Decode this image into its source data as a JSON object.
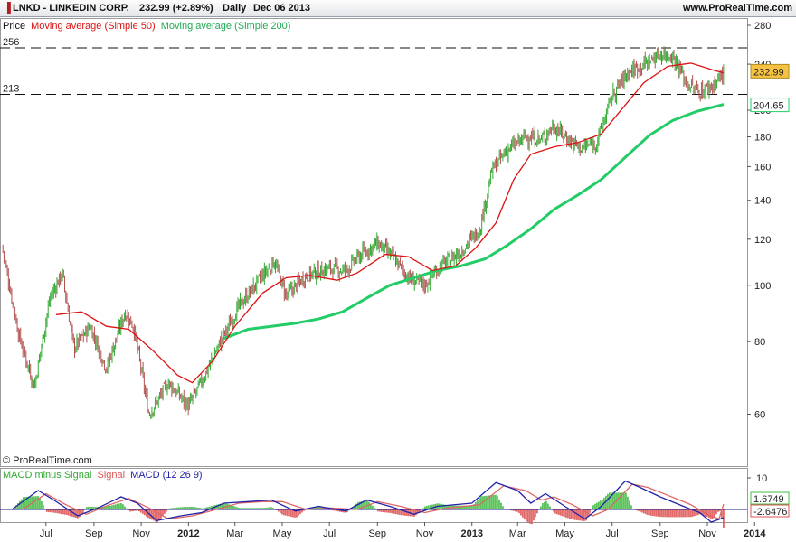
{
  "header": {
    "symbol": "LNKD - LINKEDIN CORP.",
    "price_change": "232.99 (+2.89%)",
    "period": "Daily",
    "date": "Dec 06 2013",
    "site": "www.ProRealTime.com"
  },
  "legend": {
    "price": "Price",
    "ma50": "Moving average (Simple 50)",
    "ma200": "Moving average (Simple 200)",
    "macd_hist": "MACD minus Signal",
    "macd_signal": "Signal",
    "macd_line": "MACD (12 26 9)"
  },
  "copyright": "© ProRealTime.com",
  "colors": {
    "up": "#33aa33",
    "down": "#b05050",
    "ma50": "#dd1111",
    "ma200": "#22cc66",
    "macd": "#2222aa",
    "signal": "#dd6666",
    "hist_pos": "#44bb44",
    "hist_neg": "#dd5555",
    "zero_line": "#1a1a8c",
    "price_tag": "#f5c244"
  },
  "chart_data": [
    {
      "type": "candlestick",
      "title": "LNKD - LINKEDIN CORP.",
      "scale": "log",
      "ylim": [
        54,
        280
      ],
      "yticks": [
        60,
        80,
        100,
        120,
        140,
        160,
        180,
        200,
        240,
        280
      ],
      "xticks": [
        "Jul",
        "Sep",
        "Nov",
        "2012",
        "Mar",
        "May",
        "Jul",
        "Sep",
        "Nov",
        "2013",
        "Mar",
        "May",
        "Jul",
        "Sep",
        "Nov",
        "2014"
      ],
      "x_start": "2011-05-19",
      "x_end": "2013-12-06",
      "horizontal_levels": [
        {
          "label": "256",
          "value": 256
        },
        {
          "label": "213",
          "value": 213
        }
      ],
      "last_price": {
        "label": "232.99",
        "value": 232.99
      },
      "ma200_last": {
        "label": "204.65",
        "value": 204.65
      },
      "price_path": [
        {
          "date": "2011-05-19",
          "close": 117
        },
        {
          "date": "2011-06-10",
          "close": 82
        },
        {
          "date": "2011-06-30",
          "close": 67
        },
        {
          "date": "2011-07-20",
          "close": 95
        },
        {
          "date": "2011-08-05",
          "close": 105
        },
        {
          "date": "2011-08-20",
          "close": 78
        },
        {
          "date": "2011-09-10",
          "close": 85
        },
        {
          "date": "2011-10-01",
          "close": 72
        },
        {
          "date": "2011-10-25",
          "close": 90
        },
        {
          "date": "2011-11-05",
          "close": 85
        },
        {
          "date": "2011-11-25",
          "close": 60
        },
        {
          "date": "2011-12-20",
          "close": 68
        },
        {
          "date": "2012-01-15",
          "close": 62
        },
        {
          "date": "2012-02-05",
          "close": 70
        },
        {
          "date": "2012-02-25",
          "close": 80
        },
        {
          "date": "2012-03-20",
          "close": 92
        },
        {
          "date": "2012-04-15",
          "close": 102
        },
        {
          "date": "2012-05-05",
          "close": 110
        },
        {
          "date": "2012-05-20",
          "close": 96
        },
        {
          "date": "2012-06-15",
          "close": 104
        },
        {
          "date": "2012-07-15",
          "close": 107
        },
        {
          "date": "2012-08-05",
          "close": 106
        },
        {
          "date": "2012-08-25",
          "close": 113
        },
        {
          "date": "2012-09-15",
          "close": 118
        },
        {
          "date": "2012-10-05",
          "close": 112
        },
        {
          "date": "2012-10-25",
          "close": 103
        },
        {
          "date": "2012-11-15",
          "close": 100
        },
        {
          "date": "2012-12-05",
          "close": 108
        },
        {
          "date": "2012-12-31",
          "close": 114
        },
        {
          "date": "2013-01-25",
          "close": 125
        },
        {
          "date": "2013-02-10",
          "close": 158
        },
        {
          "date": "2013-02-28",
          "close": 170
        },
        {
          "date": "2013-03-25",
          "close": 180
        },
        {
          "date": "2013-04-15",
          "close": 178
        },
        {
          "date": "2013-04-30",
          "close": 188
        },
        {
          "date": "2013-05-20",
          "close": 178
        },
        {
          "date": "2013-06-05",
          "close": 172
        },
        {
          "date": "2013-06-25",
          "close": 176
        },
        {
          "date": "2013-07-15",
          "close": 212
        },
        {
          "date": "2013-08-05",
          "close": 233
        },
        {
          "date": "2013-08-25",
          "close": 240
        },
        {
          "date": "2013-09-15",
          "close": 250
        },
        {
          "date": "2013-10-01",
          "close": 248
        },
        {
          "date": "2013-10-20",
          "close": 222
        },
        {
          "date": "2013-11-05",
          "close": 215
        },
        {
          "date": "2013-11-25",
          "close": 222
        },
        {
          "date": "2013-12-06",
          "close": 232.99
        }
      ],
      "ma50": [
        {
          "date": "2011-07-28",
          "value": 89
        },
        {
          "date": "2011-08-30",
          "value": 90
        },
        {
          "date": "2011-10-01",
          "value": 85
        },
        {
          "date": "2011-10-30",
          "value": 84
        },
        {
          "date": "2011-12-01",
          "value": 77
        },
        {
          "date": "2012-01-01",
          "value": 70
        },
        {
          "date": "2012-01-20",
          "value": 68
        },
        {
          "date": "2012-02-15",
          "value": 74
        },
        {
          "date": "2012-03-15",
          "value": 85
        },
        {
          "date": "2012-04-20",
          "value": 97
        },
        {
          "date": "2012-05-20",
          "value": 103
        },
        {
          "date": "2012-06-20",
          "value": 104
        },
        {
          "date": "2012-07-25",
          "value": 102
        },
        {
          "date": "2012-08-20",
          "value": 105
        },
        {
          "date": "2012-09-25",
          "value": 113
        },
        {
          "date": "2012-10-25",
          "value": 112
        },
        {
          "date": "2012-11-25",
          "value": 106
        },
        {
          "date": "2012-12-25",
          "value": 108
        },
        {
          "date": "2013-01-20",
          "value": 116
        },
        {
          "date": "2013-02-15",
          "value": 128
        },
        {
          "date": "2013-03-10",
          "value": 152
        },
        {
          "date": "2013-04-01",
          "value": 168
        },
        {
          "date": "2013-05-01",
          "value": 173
        },
        {
          "date": "2013-06-01",
          "value": 176
        },
        {
          "date": "2013-07-01",
          "value": 182
        },
        {
          "date": "2013-07-25",
          "value": 199
        },
        {
          "date": "2013-08-25",
          "value": 223
        },
        {
          "date": "2013-09-25",
          "value": 238
        },
        {
          "date": "2013-10-25",
          "value": 241
        },
        {
          "date": "2013-11-25",
          "value": 234
        },
        {
          "date": "2013-12-06",
          "value": 232
        }
      ],
      "ma200": [
        {
          "date": "2012-03-01",
          "value": 81
        },
        {
          "date": "2012-04-01",
          "value": 84
        },
        {
          "date": "2012-05-01",
          "value": 85
        },
        {
          "date": "2012-06-01",
          "value": 86
        },
        {
          "date": "2012-07-01",
          "value": 87.5
        },
        {
          "date": "2012-08-01",
          "value": 90
        },
        {
          "date": "2012-09-01",
          "value": 95
        },
        {
          "date": "2012-10-01",
          "value": 100
        },
        {
          "date": "2012-11-01",
          "value": 103
        },
        {
          "date": "2012-12-01",
          "value": 106
        },
        {
          "date": "2013-01-01",
          "value": 108
        },
        {
          "date": "2013-02-01",
          "value": 111
        },
        {
          "date": "2013-03-01",
          "value": 117
        },
        {
          "date": "2013-04-01",
          "value": 125
        },
        {
          "date": "2013-05-01",
          "value": 135
        },
        {
          "date": "2013-06-01",
          "value": 143
        },
        {
          "date": "2013-07-01",
          "value": 152
        },
        {
          "date": "2013-08-01",
          "value": 166
        },
        {
          "date": "2013-09-01",
          "value": 181
        },
        {
          "date": "2013-10-01",
          "value": 192
        },
        {
          "date": "2013-11-01",
          "value": 199
        },
        {
          "date": "2013-12-06",
          "value": 204.65
        }
      ]
    },
    {
      "type": "macd",
      "title": "MACD (12 26 9)",
      "ylim": [
        -4,
        12
      ],
      "yticks": [
        10
      ],
      "last_macd": {
        "label": "1.6749",
        "value": 1.6749
      },
      "last_signal": {
        "label": "-2.6476",
        "value": -2.6476
      },
      "macd": [
        {
          "date": "2011-06-01",
          "value": 0
        },
        {
          "date": "2011-07-05",
          "value": 6
        },
        {
          "date": "2011-07-25",
          "value": 3
        },
        {
          "date": "2011-08-25",
          "value": -2
        },
        {
          "date": "2011-09-20",
          "value": 0.5
        },
        {
          "date": "2011-10-20",
          "value": 4
        },
        {
          "date": "2011-11-10",
          "value": 2
        },
        {
          "date": "2011-12-05",
          "value": -3.5
        },
        {
          "date": "2012-01-05",
          "value": -2
        },
        {
          "date": "2012-02-01",
          "value": -1
        },
        {
          "date": "2012-03-01",
          "value": 2
        },
        {
          "date": "2012-04-01",
          "value": 2.5
        },
        {
          "date": "2012-05-01",
          "value": 3
        },
        {
          "date": "2012-06-01",
          "value": -0.5
        },
        {
          "date": "2012-07-01",
          "value": 1
        },
        {
          "date": "2012-08-05",
          "value": -0.5
        },
        {
          "date": "2012-09-01",
          "value": 3
        },
        {
          "date": "2012-10-01",
          "value": 1
        },
        {
          "date": "2012-11-01",
          "value": -1.5
        },
        {
          "date": "2012-12-01",
          "value": 1
        },
        {
          "date": "2013-01-15",
          "value": 2
        },
        {
          "date": "2013-02-15",
          "value": 8.5
        },
        {
          "date": "2013-03-15",
          "value": 6
        },
        {
          "date": "2013-04-01",
          "value": 2
        },
        {
          "date": "2013-04-20",
          "value": 5
        },
        {
          "date": "2013-05-15",
          "value": 1
        },
        {
          "date": "2013-06-10",
          "value": -3
        },
        {
          "date": "2013-07-01",
          "value": 1
        },
        {
          "date": "2013-08-01",
          "value": 9
        },
        {
          "date": "2013-08-20",
          "value": 7
        },
        {
          "date": "2013-09-15",
          "value": 4
        },
        {
          "date": "2013-10-15",
          "value": 1
        },
        {
          "date": "2013-11-05",
          "value": -1
        },
        {
          "date": "2013-11-20",
          "value": -4
        },
        {
          "date": "2013-12-06",
          "value": -2.6
        }
      ],
      "signal": [
        {
          "date": "2011-06-15",
          "value": 0
        },
        {
          "date": "2011-07-15",
          "value": 5
        },
        {
          "date": "2011-08-10",
          "value": 1.5
        },
        {
          "date": "2011-09-05",
          "value": -1.5
        },
        {
          "date": "2011-10-05",
          "value": 1.5
        },
        {
          "date": "2011-10-30",
          "value": 3.5
        },
        {
          "date": "2011-11-25",
          "value": 0.5
        },
        {
          "date": "2011-12-20",
          "value": -3
        },
        {
          "date": "2012-01-20",
          "value": -2
        },
        {
          "date": "2012-02-20",
          "value": 0
        },
        {
          "date": "2012-03-20",
          "value": 2
        },
        {
          "date": "2012-04-20",
          "value": 2.5
        },
        {
          "date": "2012-05-15",
          "value": 2.5
        },
        {
          "date": "2012-06-15",
          "value": 0
        },
        {
          "date": "2012-07-15",
          "value": 0.5
        },
        {
          "date": "2012-08-20",
          "value": 0
        },
        {
          "date": "2012-09-15",
          "value": 2.5
        },
        {
          "date": "2012-10-15",
          "value": 1
        },
        {
          "date": "2012-11-15",
          "value": -1
        },
        {
          "date": "2012-12-15",
          "value": 0.5
        },
        {
          "date": "2013-01-25",
          "value": 1.5
        },
        {
          "date": "2013-02-25",
          "value": 7.5
        },
        {
          "date": "2013-03-25",
          "value": 6
        },
        {
          "date": "2013-04-15",
          "value": 3
        },
        {
          "date": "2013-05-01",
          "value": 4
        },
        {
          "date": "2013-05-25",
          "value": 1.5
        },
        {
          "date": "2013-06-20",
          "value": -2
        },
        {
          "date": "2013-07-10",
          "value": 0
        },
        {
          "date": "2013-08-10",
          "value": 8
        },
        {
          "date": "2013-08-30",
          "value": 7
        },
        {
          "date": "2013-09-25",
          "value": 4.5
        },
        {
          "date": "2013-10-25",
          "value": 1.5
        },
        {
          "date": "2013-11-15",
          "value": -1.5
        },
        {
          "date": "2013-11-30",
          "value": -3
        },
        {
          "date": "2013-12-06",
          "value": 1.6749
        }
      ]
    }
  ]
}
